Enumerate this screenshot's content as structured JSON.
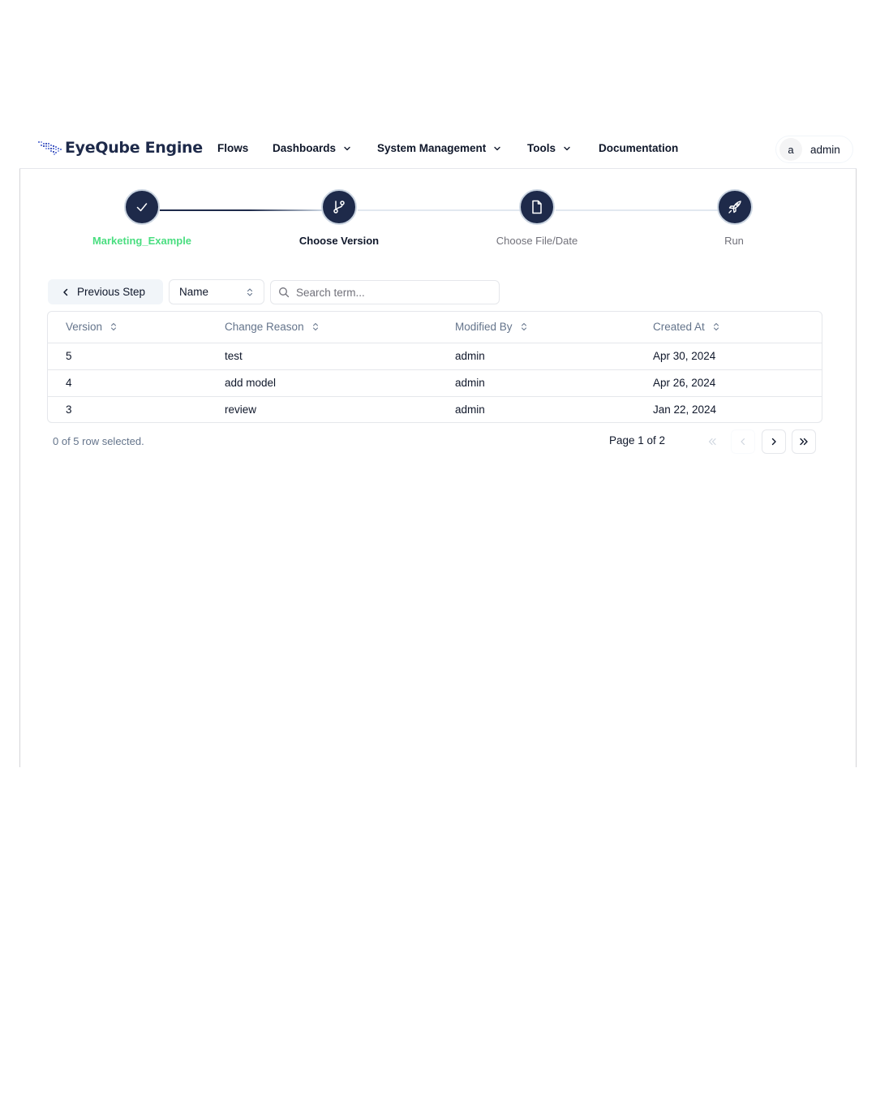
{
  "header": {
    "brand": "EyeQube Engine",
    "nav": {
      "flows": "Flows",
      "dashboards": "Dashboards",
      "system_management": "System Management",
      "tools": "Tools",
      "documentation": "Documentation"
    },
    "user": {
      "avatar_initial": "a",
      "name": "admin"
    }
  },
  "stepper": {
    "steps": [
      {
        "label": "Marketing_Example",
        "icon": "check-icon",
        "state": "completed"
      },
      {
        "label": "Choose Version",
        "icon": "git-branch-icon",
        "state": "current"
      },
      {
        "label": "Choose File/Date",
        "icon": "file-icon",
        "state": "upcoming"
      },
      {
        "label": "Run",
        "icon": "rocket-icon",
        "state": "upcoming"
      }
    ],
    "colors": {
      "completed": "#4ade80",
      "current": "#0f172a",
      "upcoming": "#71717a",
      "circle": "#1e2a4a"
    }
  },
  "toolbar": {
    "previous_label": "Previous Step",
    "filter_select_value": "Name",
    "search_placeholder": "Search term..."
  },
  "table": {
    "columns": [
      "Version",
      "Change Reason",
      "Modified By",
      "Created At"
    ],
    "rows": [
      [
        "5",
        "test",
        "admin",
        "Apr 30, 2024"
      ],
      [
        "4",
        "add model",
        "admin",
        "Apr 26, 2024"
      ],
      [
        "3",
        "review",
        "admin",
        "Jan 22, 2024"
      ]
    ]
  },
  "footer": {
    "selection": "0 of 5 row selected.",
    "page": "Page 1 of 2"
  }
}
